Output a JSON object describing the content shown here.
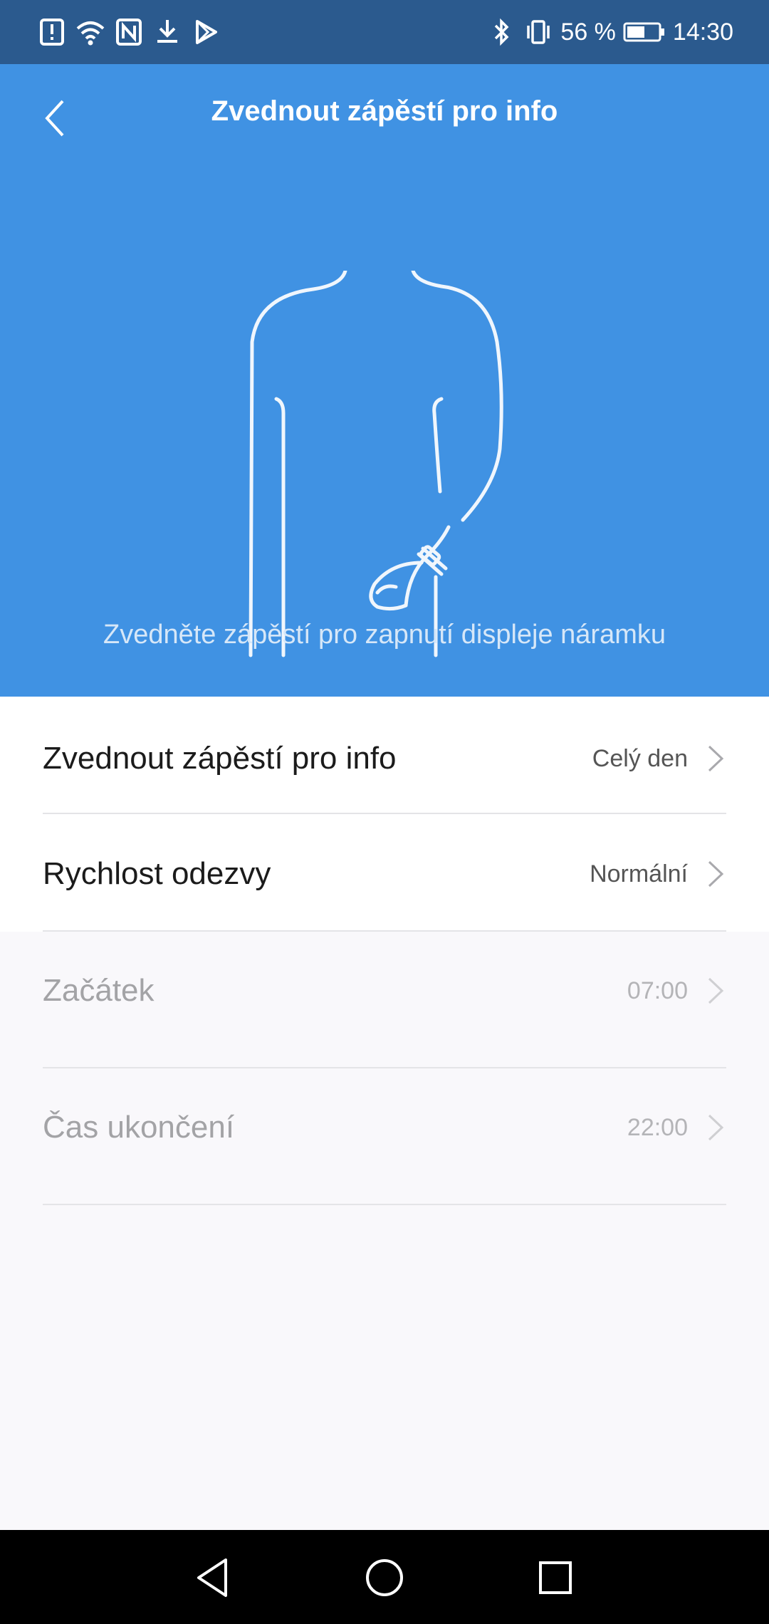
{
  "status_bar": {
    "icons_left": [
      "alert-icon",
      "wifi-icon",
      "nfc-icon",
      "download-icon",
      "play-store-icon"
    ],
    "icons_right": [
      "bluetooth-icon",
      "vibrate-icon",
      "battery-icon"
    ],
    "battery": "56 %",
    "battery_level": 0.56,
    "time": "14:30"
  },
  "header": {
    "title": "Zvednout zápěstí pro info",
    "back_icon": "chevron-left-icon"
  },
  "hero": {
    "caption": "Zvedněte zápěstí pro zapnutí displeje náramku",
    "illustration": "person-raising-wrist-with-band"
  },
  "settings": [
    {
      "label": "Zvednout zápěstí pro info",
      "value": "Celý den",
      "enabled": true
    },
    {
      "label": "Rychlost odezvy",
      "value": "Normální",
      "enabled": true
    },
    {
      "label": "Začátek",
      "value": "07:00",
      "enabled": false
    },
    {
      "label": "Čas ukončení",
      "value": "22:00",
      "enabled": false
    }
  ],
  "nav_bar": {
    "buttons": [
      "back-triangle-icon",
      "home-circle-icon",
      "recents-square-icon"
    ]
  },
  "colors": {
    "status_bar": "#2b5a8e",
    "header": "#4092e3",
    "background": "#f9f8fb",
    "nav_bar": "#000000"
  }
}
